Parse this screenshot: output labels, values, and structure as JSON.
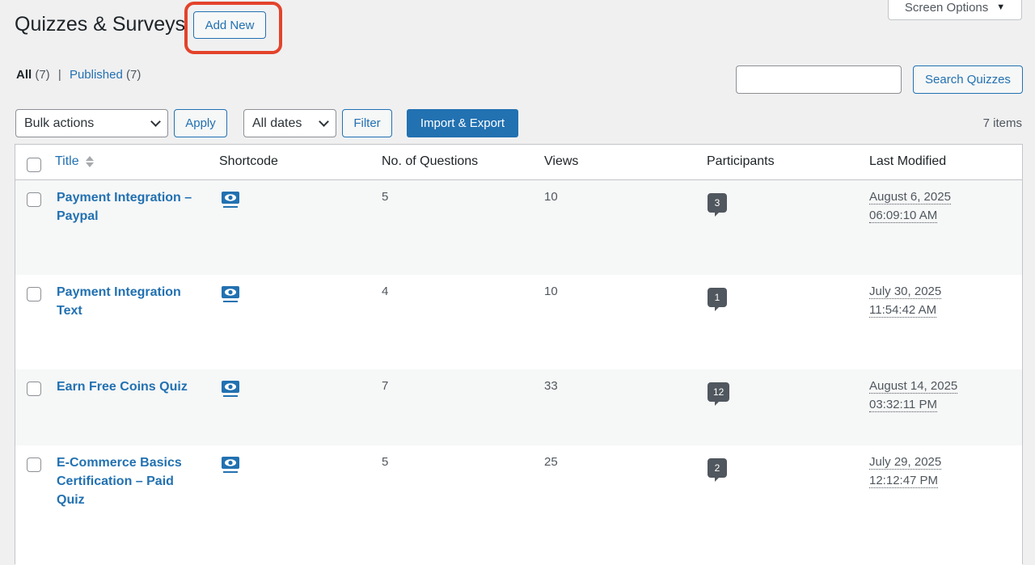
{
  "header": {
    "title": "Quizzes & Surveys",
    "add_new_label": "Add New",
    "screen_options_label": "Screen Options"
  },
  "views": {
    "all_label": "All",
    "all_count": "(7)",
    "separator": "|",
    "published_label": "Published",
    "published_count": "(7)"
  },
  "search": {
    "value": "",
    "button_label": "Search Quizzes"
  },
  "tablenav": {
    "bulk_actions_selected": "Bulk actions",
    "apply_label": "Apply",
    "dates_selected": "All dates",
    "filter_label": "Filter",
    "import_export_label": "Import & Export",
    "items_count": "7 items"
  },
  "table": {
    "columns": {
      "title": "Title",
      "shortcode": "Shortcode",
      "questions": "No. of Questions",
      "views": "Views",
      "participants": "Participants",
      "last_modified": "Last Modified"
    },
    "rows": [
      {
        "title": "Payment Integration – Paypal",
        "questions": "5",
        "views": "10",
        "participants": "3",
        "date": "August 6, 2025",
        "time": "06:09:10 AM"
      },
      {
        "title": "Payment Integration Text",
        "questions": "4",
        "views": "10",
        "participants": "1",
        "date": "July 30, 2025",
        "time": "11:54:42 AM"
      },
      {
        "title": "Earn Free Coins Quiz",
        "questions": "7",
        "views": "33",
        "participants": "12",
        "date": "August 14, 2025",
        "time": "03:32:11 PM"
      },
      {
        "title": "E-Commerce Basics Certification – Paid Quiz",
        "questions": "5",
        "views": "25",
        "participants": "2",
        "date": "July 29, 2025",
        "time": "12:12:47 PM"
      }
    ]
  },
  "colors": {
    "link": "#2271b1",
    "highlight": "#e3432b",
    "bubble": "#50575e"
  }
}
